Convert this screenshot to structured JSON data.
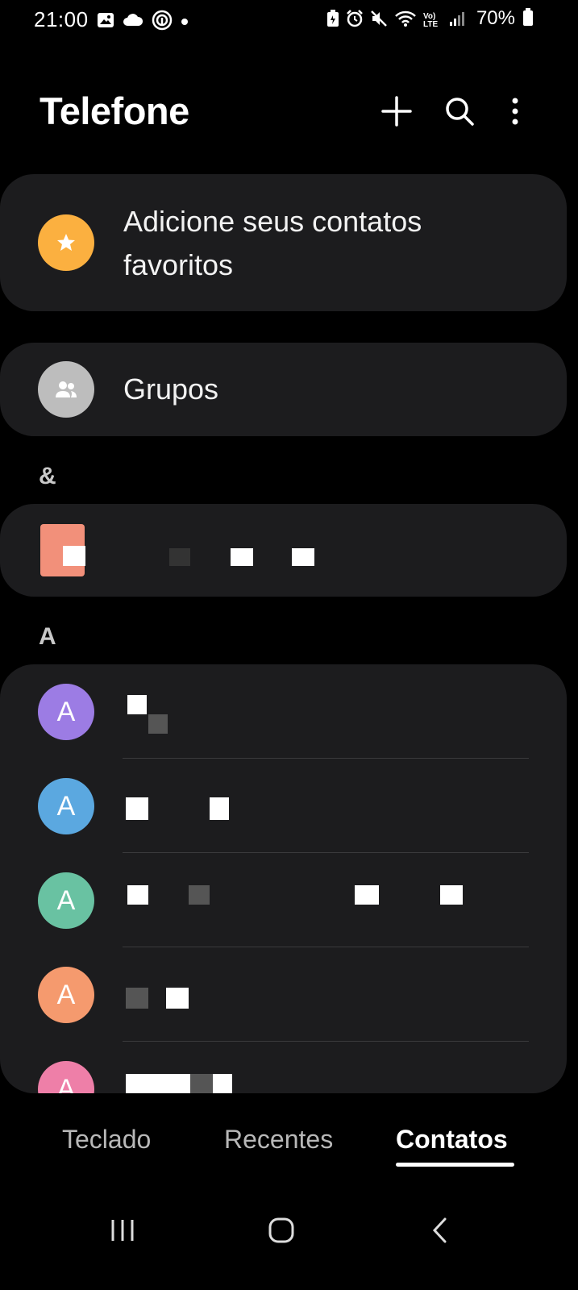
{
  "status_bar": {
    "time": "21:00",
    "battery": "70%",
    "network_label": "Vo) LTE",
    "icons_left": [
      "gallery-icon",
      "cloud-icon",
      "fingerprint-icon",
      "dot-icon"
    ],
    "icons_right": [
      "battery-saver-icon",
      "alarm-icon",
      "mute-icon",
      "wifi-icon",
      "volte-icon",
      "signal-icon"
    ]
  },
  "header": {
    "title": "Telefone",
    "actions": [
      "add-icon",
      "search-icon",
      "more-icon"
    ]
  },
  "favorites": {
    "label": "Adicione seus contatos favoritos",
    "icon": "star-icon",
    "color": "#FBB040"
  },
  "groups": {
    "label": "Grupos",
    "icon": "people-icon",
    "color": "#BDBDBD"
  },
  "sections": [
    {
      "letter": "&"
    },
    {
      "letter": "A"
    }
  ],
  "contacts_a": [
    {
      "initial": "A",
      "color": "#9C7CE4"
    },
    {
      "initial": "A",
      "color": "#5BA8E0"
    },
    {
      "initial": "A",
      "color": "#69C2A2"
    },
    {
      "initial": "A",
      "color": "#F59A6E"
    },
    {
      "initial": "A",
      "color": "#EE7FA8"
    }
  ],
  "tabs": [
    {
      "label": "Teclado",
      "active": false
    },
    {
      "label": "Recentes",
      "active": false
    },
    {
      "label": "Contatos",
      "active": true
    }
  ],
  "nav": [
    "recents-nav-icon",
    "home-nav-icon",
    "back-nav-icon"
  ]
}
